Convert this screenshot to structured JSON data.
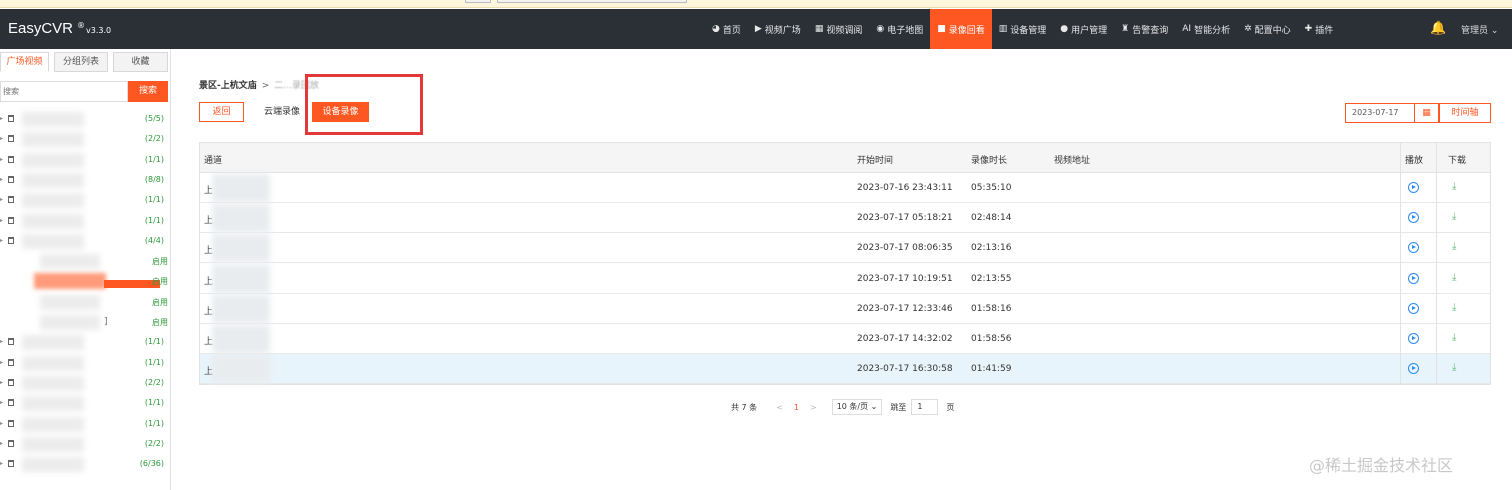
{
  "header": {
    "brand": "EasyCVR",
    "brand_reg": "®",
    "version": "v3.3.0",
    "nav": [
      {
        "icon": "dashboard-icon",
        "glyph": "◕",
        "label": "首页"
      },
      {
        "icon": "video-plaza-icon",
        "glyph": "▶",
        "label": "视频广场"
      },
      {
        "icon": "video-layout-icon",
        "glyph": "▦",
        "label": "视频调阅"
      },
      {
        "icon": "map-marker-icon",
        "glyph": "◉",
        "label": "电子地图"
      },
      {
        "icon": "camera-icon",
        "glyph": "■",
        "label": "录像回看",
        "active": true
      },
      {
        "icon": "device-icon",
        "glyph": "▥",
        "label": "设备管理"
      },
      {
        "icon": "user-icon",
        "glyph": "●",
        "label": "用户管理"
      },
      {
        "icon": "alarm-icon",
        "glyph": "♜",
        "label": "告警查询"
      },
      {
        "icon": "ai-icon",
        "glyph": "AI",
        "label": "智能分析"
      },
      {
        "icon": "gear-icon",
        "glyph": "✲",
        "label": "配置中心"
      },
      {
        "icon": "plugin-icon",
        "glyph": "✚",
        "label": "插件"
      }
    ],
    "bell_glyph": "🔔",
    "user": "管理员 ⌄"
  },
  "sidebar": {
    "tabs": [
      "广场视频",
      "分组列表",
      "收藏"
    ],
    "search_placeholder": "搜索",
    "search_button": "搜索",
    "tree": [
      {
        "count": "(5/5)"
      },
      {
        "count": "(2/2)"
      },
      {
        "count": "(1/1)"
      },
      {
        "count": "(8/8)"
      },
      {
        "count": "(1/1)"
      },
      {
        "count": "(1/1)"
      },
      {
        "count": "(4/4)"
      },
      {
        "status": "启用"
      },
      {
        "status": "启用",
        "selected": true
      },
      {
        "status": "启用"
      },
      {
        "status": "启用",
        "suffix": "]"
      },
      {
        "count": "(1/1)"
      },
      {
        "count": "(1/1)"
      },
      {
        "count": "(2/2)"
      },
      {
        "count": "(1/1)"
      },
      {
        "count": "(1/1)"
      },
      {
        "count": "(2/2)"
      },
      {
        "count": "(6/36)"
      }
    ]
  },
  "main": {
    "breadcrumb": {
      "root": "景区-上杭文庙",
      "sep": ">",
      "current": "二...录回放"
    },
    "buttons": {
      "back": "返回",
      "cloud": "云端录像",
      "device": "设备录像"
    },
    "date": "2023-07-17",
    "calendar_glyph": "▦",
    "timeline": "时间轴",
    "table": {
      "headers": {
        "channel": "通道",
        "start": "开始时间",
        "duration": "录像时长",
        "url": "视频地址",
        "play": "播放",
        "download": "下载"
      },
      "rows": [
        {
          "channel": "上",
          "start": "2023-07-16 23:43:11",
          "duration": "05:35:10"
        },
        {
          "channel": "上",
          "start": "2023-07-17 05:18:21",
          "duration": "02:48:14"
        },
        {
          "channel": "上",
          "start": "2023-07-17 08:06:35",
          "duration": "02:13:16"
        },
        {
          "channel": "上",
          "start": "2023-07-17 10:19:51",
          "duration": "02:13:55"
        },
        {
          "channel": "上",
          "start": "2023-07-17 12:33:46",
          "duration": "01:58:16"
        },
        {
          "channel": "上",
          "start": "2023-07-17 14:32:02",
          "duration": "01:58:56"
        },
        {
          "channel": "上",
          "start": "2023-07-17 16:30:58",
          "duration": "01:41:59"
        }
      ],
      "download_glyph": "⤓"
    },
    "pager": {
      "total": "共 7 条",
      "prev": "<",
      "current": "1",
      "next": ">",
      "size": "10 条/页 ⌄",
      "goto": "跳至",
      "page": "1",
      "page_unit": "页"
    }
  },
  "watermark": "@稀土掘金技术社区",
  "colors": {
    "accent": "#ff5722",
    "header_bg": "#2b2f36",
    "count_green": "#2e9a3a",
    "highlight_red": "#e23838",
    "play_blue": "#2d8cf0",
    "download_green": "#5fb878"
  }
}
